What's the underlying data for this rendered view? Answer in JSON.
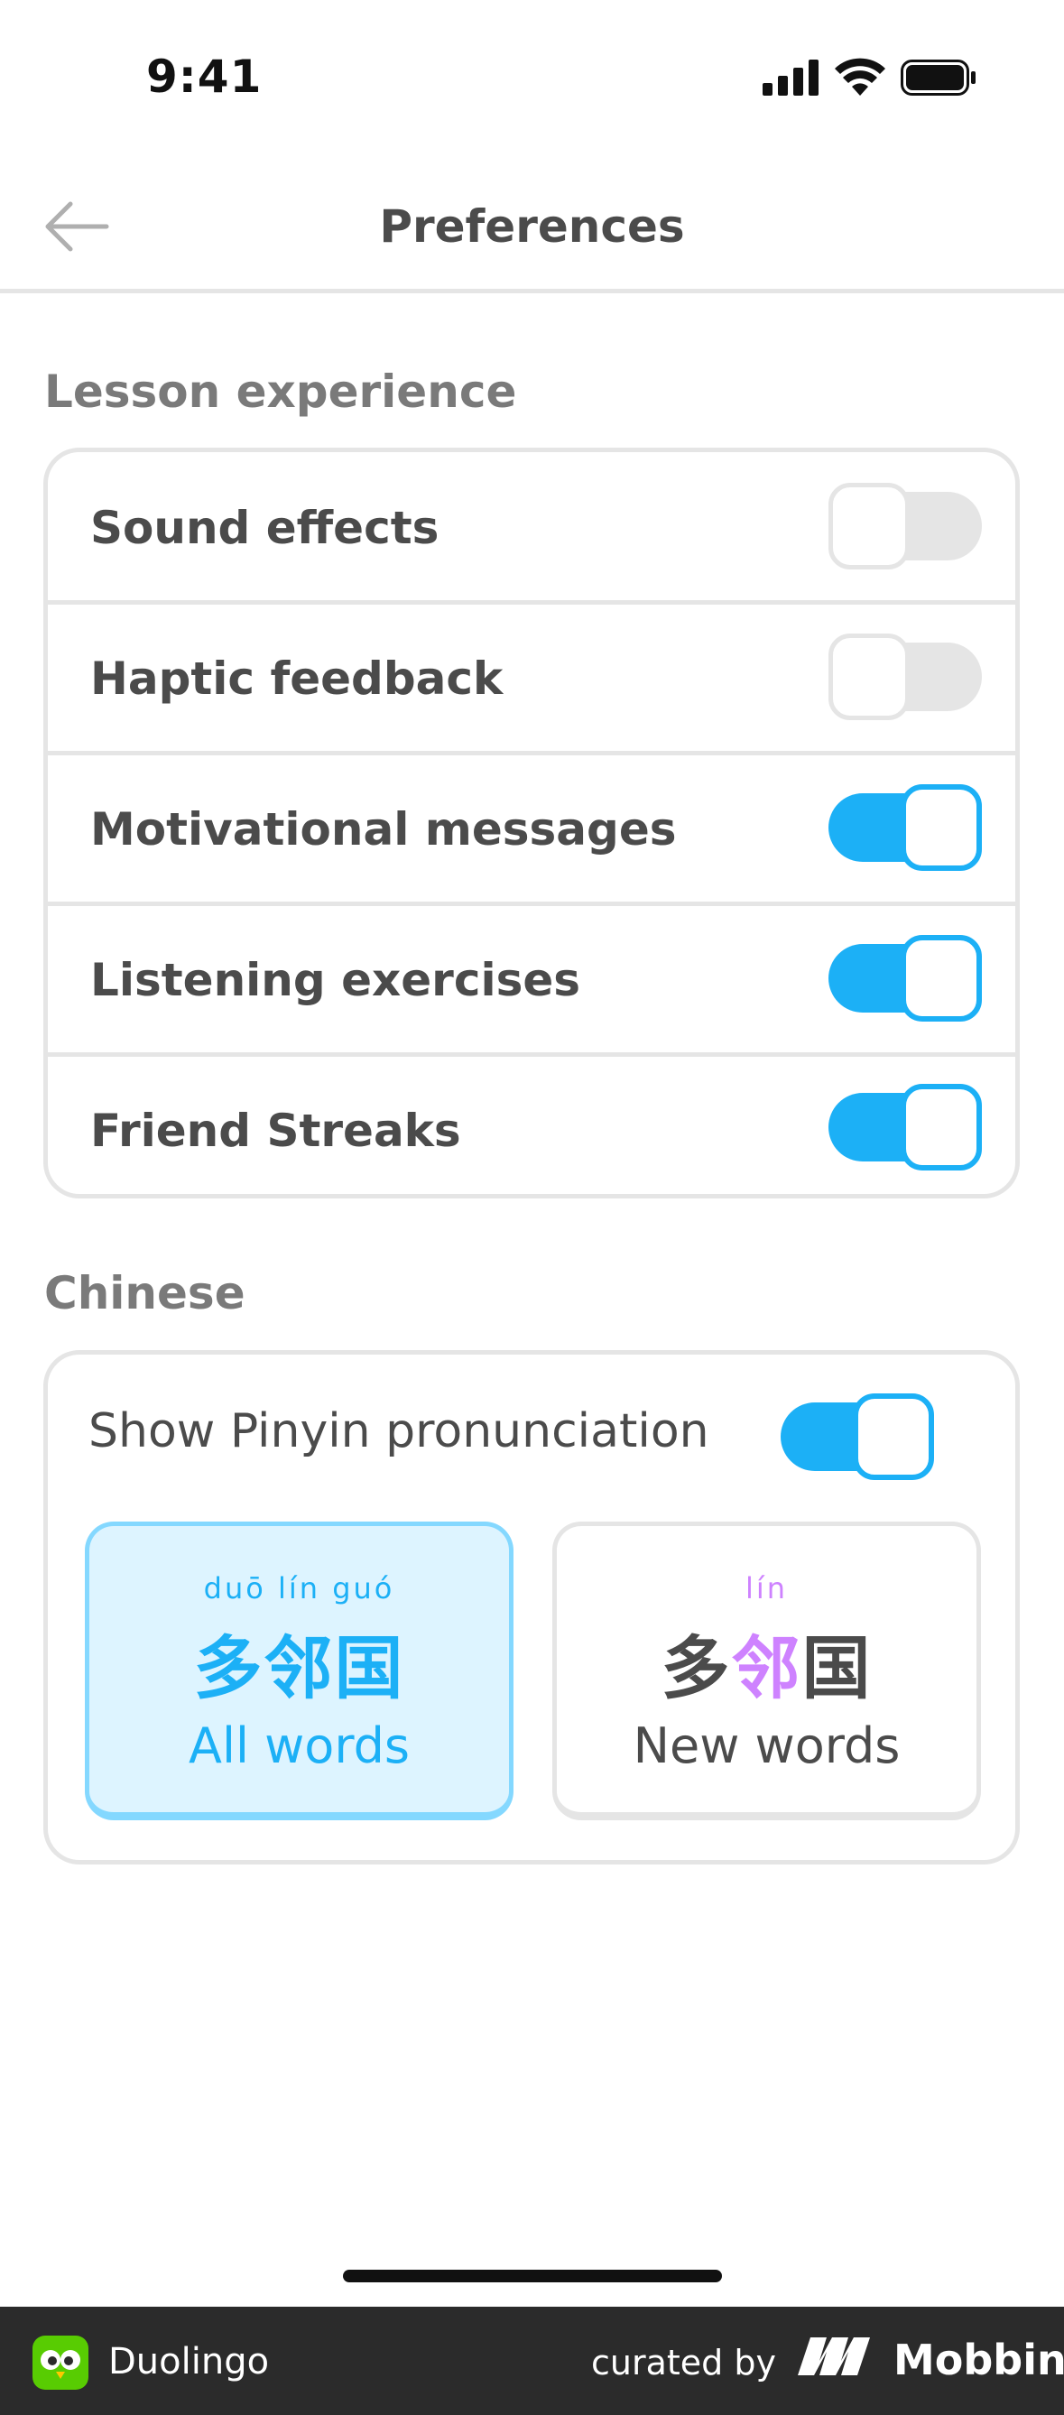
{
  "status_bar": {
    "time": "9:41"
  },
  "header": {
    "title": "Preferences"
  },
  "lesson": {
    "section_title": "Lesson experience",
    "items": [
      {
        "label": "Sound effects",
        "on": false
      },
      {
        "label": "Haptic feedback",
        "on": false
      },
      {
        "label": "Motivational messages",
        "on": true
      },
      {
        "label": "Listening exercises",
        "on": true
      },
      {
        "label": "Friend Streaks",
        "on": true
      }
    ]
  },
  "chinese": {
    "section_title": "Chinese",
    "pinyin_label": "Show Pinyin pronunciation",
    "pinyin_on": true,
    "options": [
      {
        "pinyin": "duō  lín  guó",
        "hanzi": "多邻国",
        "label": "All words",
        "selected": true
      },
      {
        "pinyin": "lín",
        "hanzi_pre": "多",
        "hanzi_mid": "邻",
        "hanzi_post": "国",
        "label": "New words",
        "selected": false
      }
    ]
  },
  "footer": {
    "app_name": "Duolingo",
    "curated_by": "curated by",
    "brand": "Mobbin"
  },
  "colors": {
    "accent": "#1cb0f6",
    "selected_bg": "#ddf4ff",
    "selected_border": "#84d8ff",
    "purple": "#ce82ff",
    "brand_green": "#58cc02"
  }
}
